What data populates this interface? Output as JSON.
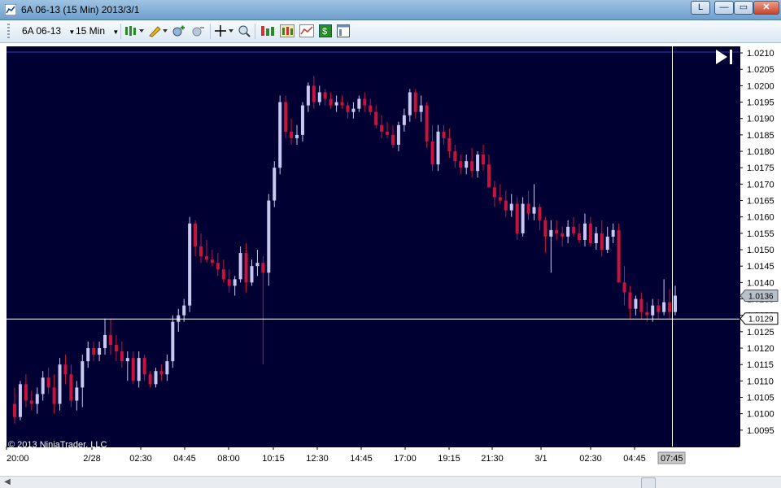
{
  "window": {
    "title": "6A 06-13 (15 Min)  2013/3/1",
    "buttons": {
      "l_label": "L",
      "min_label": "—",
      "max_label": "▭",
      "close_label": "✕"
    }
  },
  "toolbar": {
    "instrument": "6A 06-13",
    "interval": "15 Min",
    "icons": [
      "bars-type-icon",
      "pencil-draw-icon",
      "zoom-in-icon",
      "zoom-out-icon",
      "crosshair-icon",
      "magnify-icon",
      "chart-properties-icon",
      "indicators-icon",
      "strategies-icon",
      "dollar-icon",
      "data-box-icon"
    ]
  },
  "colors": {
    "background": "#000033",
    "up_candle": "#c8c8f0",
    "down_candle": "#c8143c",
    "axis_text": "#000000",
    "crosshair": "#ffffff",
    "top_line": "#3a3aa8"
  },
  "chart_data": {
    "type": "candlestick",
    "instrument": "6A 06-13",
    "period": "15 Min",
    "ylim": [
      1.009,
      1.0212
    ],
    "y_ticks": [
      "1.0210",
      "1.0205",
      "1.0200",
      "1.0195",
      "1.0190",
      "1.0185",
      "1.0180",
      "1.0175",
      "1.0170",
      "1.0165",
      "1.0160",
      "1.0155",
      "1.0150",
      "1.0145",
      "1.0140",
      "1.0135",
      "1.0130",
      "1.0125",
      "1.0120",
      "1.0115",
      "1.0110",
      "1.0105",
      "1.0100",
      "1.0095"
    ],
    "x_ticks": [
      "20:00",
      "2/28",
      "02:30",
      "04:45",
      "08:00",
      "10:15",
      "12:30",
      "14:45",
      "17:00",
      "19:15",
      "21:30",
      "3/1",
      "02:30",
      "04:45",
      "07:45"
    ],
    "last_price_label": "1.0136",
    "crosshair_price_label": "1.0129",
    "crosshair_time_label": "07:45",
    "copyright": "© 2013 NinjaTrader, LLC",
    "bars": [
      [
        1.0103,
        1.0108,
        1.0097,
        1.0099
      ],
      [
        1.0099,
        1.011,
        1.0098,
        1.0109
      ],
      [
        1.0109,
        1.0112,
        1.0102,
        1.0104
      ],
      [
        1.0104,
        1.0107,
        1.0101,
        1.0103
      ],
      [
        1.0103,
        1.0108,
        1.01,
        1.0106
      ],
      [
        1.0106,
        1.0113,
        1.0104,
        1.0111
      ],
      [
        1.0111,
        1.0114,
        1.0106,
        1.0108
      ],
      [
        1.0108,
        1.0112,
        1.01,
        1.0103
      ],
      [
        1.0103,
        1.0117,
        1.0101,
        1.0115
      ],
      [
        1.0115,
        1.0118,
        1.0109,
        1.0112
      ],
      [
        1.0112,
        1.0115,
        1.0102,
        1.0104
      ],
      [
        1.0104,
        1.011,
        1.0101,
        1.0108
      ],
      [
        1.0108,
        1.0118,
        1.0102,
        1.0116
      ],
      [
        1.0116,
        1.0122,
        1.0114,
        1.012
      ],
      [
        1.012,
        1.0122,
        1.0116,
        1.0118
      ],
      [
        1.0118,
        1.0122,
        1.0116,
        1.012
      ],
      [
        1.012,
        1.0129,
        1.0118,
        1.0124
      ],
      [
        1.0124,
        1.0129,
        1.0118,
        1.0121
      ],
      [
        1.0121,
        1.0124,
        1.0116,
        1.0119
      ],
      [
        1.0119,
        1.0122,
        1.0114,
        1.0116
      ],
      [
        1.0116,
        1.0119,
        1.011,
        1.0117
      ],
      [
        1.0117,
        1.0119,
        1.0109,
        1.011
      ],
      [
        1.011,
        1.0119,
        1.0108,
        1.0117
      ],
      [
        1.0117,
        1.0118,
        1.011,
        1.0112
      ],
      [
        1.0112,
        1.0113,
        1.0108,
        1.0109
      ],
      [
        1.0109,
        1.0114,
        1.0108,
        1.0113
      ],
      [
        1.0113,
        1.0115,
        1.011,
        1.0112
      ],
      [
        1.0112,
        1.0118,
        1.011,
        1.0116
      ],
      [
        1.0116,
        1.013,
        1.0114,
        1.0128
      ],
      [
        1.0128,
        1.0132,
        1.0125,
        1.013
      ],
      [
        1.013,
        1.0135,
        1.0128,
        1.0133
      ],
      [
        1.0133,
        1.016,
        1.0131,
        1.0158
      ],
      [
        1.0158,
        1.0159,
        1.0148,
        1.0151
      ],
      [
        1.0151,
        1.0155,
        1.0146,
        1.0148
      ],
      [
        1.0148,
        1.0153,
        1.0146,
        1.0147
      ],
      [
        1.0147,
        1.015,
        1.0145,
        1.0146
      ],
      [
        1.0146,
        1.0149,
        1.0142,
        1.0144
      ],
      [
        1.0144,
        1.0147,
        1.014,
        1.0141
      ],
      [
        1.0141,
        1.0144,
        1.0137,
        1.0139
      ],
      [
        1.0139,
        1.0142,
        1.0136,
        1.0141
      ],
      [
        1.0141,
        1.0151,
        1.014,
        1.0149
      ],
      [
        1.0149,
        1.0152,
        1.0137,
        1.014
      ],
      [
        1.014,
        1.0147,
        1.0139,
        1.0145
      ],
      [
        1.0145,
        1.015,
        1.0142,
        1.0146
      ],
      [
        1.0146,
        1.0148,
        1.0115,
        1.0143
      ],
      [
        1.0143,
        1.0167,
        1.0139,
        1.0165
      ],
      [
        1.0165,
        1.0177,
        1.0163,
        1.0175
      ],
      [
        1.0175,
        1.0197,
        1.0173,
        1.0195
      ],
      [
        1.0195,
        1.0197,
        1.0184,
        1.0186
      ],
      [
        1.0186,
        1.019,
        1.0182,
        1.0184
      ],
      [
        1.0184,
        1.0188,
        1.0182,
        1.0185
      ],
      [
        1.0185,
        1.0195,
        1.0183,
        1.0194
      ],
      [
        1.0194,
        1.0201,
        1.0192,
        1.02
      ],
      [
        1.02,
        1.0203,
        1.0193,
        1.0195
      ],
      [
        1.0195,
        1.02,
        1.0194,
        1.0198
      ],
      [
        1.0198,
        1.0199,
        1.0194,
        1.0196
      ],
      [
        1.0196,
        1.0198,
        1.0193,
        1.0194
      ],
      [
        1.0194,
        1.0197,
        1.0192,
        1.0195
      ],
      [
        1.0195,
        1.0197,
        1.0193,
        1.0194
      ],
      [
        1.0194,
        1.0195,
        1.019,
        1.0192
      ],
      [
        1.0192,
        1.0195,
        1.019,
        1.0193
      ],
      [
        1.0193,
        1.0197,
        1.0192,
        1.0196
      ],
      [
        1.0196,
        1.0198,
        1.0192,
        1.0194
      ],
      [
        1.0194,
        1.0196,
        1.0191,
        1.0192
      ],
      [
        1.0192,
        1.0194,
        1.0187,
        1.0188
      ],
      [
        1.0188,
        1.0191,
        1.0184,
        1.0186
      ],
      [
        1.0186,
        1.0189,
        1.0184,
        1.0185
      ],
      [
        1.0185,
        1.0188,
        1.0181,
        1.0182
      ],
      [
        1.0182,
        1.0189,
        1.018,
        1.0188
      ],
      [
        1.0188,
        1.0193,
        1.0186,
        1.0191
      ],
      [
        1.0191,
        1.0199,
        1.0189,
        1.0198
      ],
      [
        1.0198,
        1.0199,
        1.019,
        1.0192
      ],
      [
        1.0192,
        1.0197,
        1.0189,
        1.0194
      ],
      [
        1.0194,
        1.0195,
        1.0181,
        1.0183
      ],
      [
        1.0183,
        1.0188,
        1.0174,
        1.0176
      ],
      [
        1.0176,
        1.0188,
        1.0174,
        1.0186
      ],
      [
        1.0186,
        1.0188,
        1.0182,
        1.0184
      ],
      [
        1.0184,
        1.0187,
        1.0178,
        1.018
      ],
      [
        1.018,
        1.0182,
        1.0175,
        1.0177
      ],
      [
        1.0177,
        1.0179,
        1.0173,
        1.0175
      ],
      [
        1.0175,
        1.0179,
        1.0173,
        1.0177
      ],
      [
        1.0177,
        1.0181,
        1.0172,
        1.0174
      ],
      [
        1.0174,
        1.018,
        1.0172,
        1.0179
      ],
      [
        1.0179,
        1.0182,
        1.0174,
        1.0176
      ],
      [
        1.0176,
        1.0179,
        1.0169,
        1.0169
      ],
      [
        1.0169,
        1.0171,
        1.0163,
        1.0166
      ],
      [
        1.0166,
        1.017,
        1.0164,
        1.0165
      ],
      [
        1.0165,
        1.0168,
        1.016,
        1.0162
      ],
      [
        1.0162,
        1.0167,
        1.016,
        1.0164
      ],
      [
        1.0164,
        1.0166,
        1.0153,
        1.0155
      ],
      [
        1.0155,
        1.0166,
        1.0154,
        1.0164
      ],
      [
        1.0164,
        1.0168,
        1.0159,
        1.0161
      ],
      [
        1.0161,
        1.017,
        1.0159,
        1.0163
      ],
      [
        1.0163,
        1.0164,
        1.0156,
        1.0159
      ],
      [
        1.0159,
        1.016,
        1.0149,
        1.0154
      ],
      [
        1.0154,
        1.0159,
        1.0143,
        1.0156
      ],
      [
        1.0156,
        1.0159,
        1.0153,
        1.0155
      ],
      [
        1.0155,
        1.0157,
        1.0151,
        1.0154
      ],
      [
        1.0154,
        1.0159,
        1.0152,
        1.0157
      ],
      [
        1.0157,
        1.016,
        1.0154,
        1.0155
      ],
      [
        1.0155,
        1.0158,
        1.0152,
        1.0153
      ],
      [
        1.0153,
        1.0161,
        1.0151,
        1.0158
      ],
      [
        1.0158,
        1.016,
        1.0151,
        1.0152
      ],
      [
        1.0152,
        1.0157,
        1.015,
        1.0155
      ],
      [
        1.0155,
        1.0159,
        1.0148,
        1.015
      ],
      [
        1.015,
        1.0157,
        1.0149,
        1.0154
      ],
      [
        1.0154,
        1.0158,
        1.0152,
        1.0156
      ],
      [
        1.0156,
        1.0158,
        1.0145,
        1.014
      ],
      [
        1.014,
        1.0145,
        1.0133,
        1.0137
      ],
      [
        1.0137,
        1.0139,
        1.0129,
        1.0132
      ],
      [
        1.0132,
        1.0136,
        1.013,
        1.0135
      ],
      [
        1.0135,
        1.0137,
        1.0129,
        1.0131
      ],
      [
        1.0131,
        1.0134,
        1.0128,
        1.013
      ],
      [
        1.013,
        1.0135,
        1.0128,
        1.0133
      ],
      [
        1.0133,
        1.0135,
        1.0129,
        1.0131
      ],
      [
        1.0131,
        1.0141,
        1.013,
        1.0134
      ],
      [
        1.0134,
        1.0138,
        1.0129,
        1.0131
      ],
      [
        1.0131,
        1.0139,
        1.013,
        1.0136
      ]
    ]
  }
}
